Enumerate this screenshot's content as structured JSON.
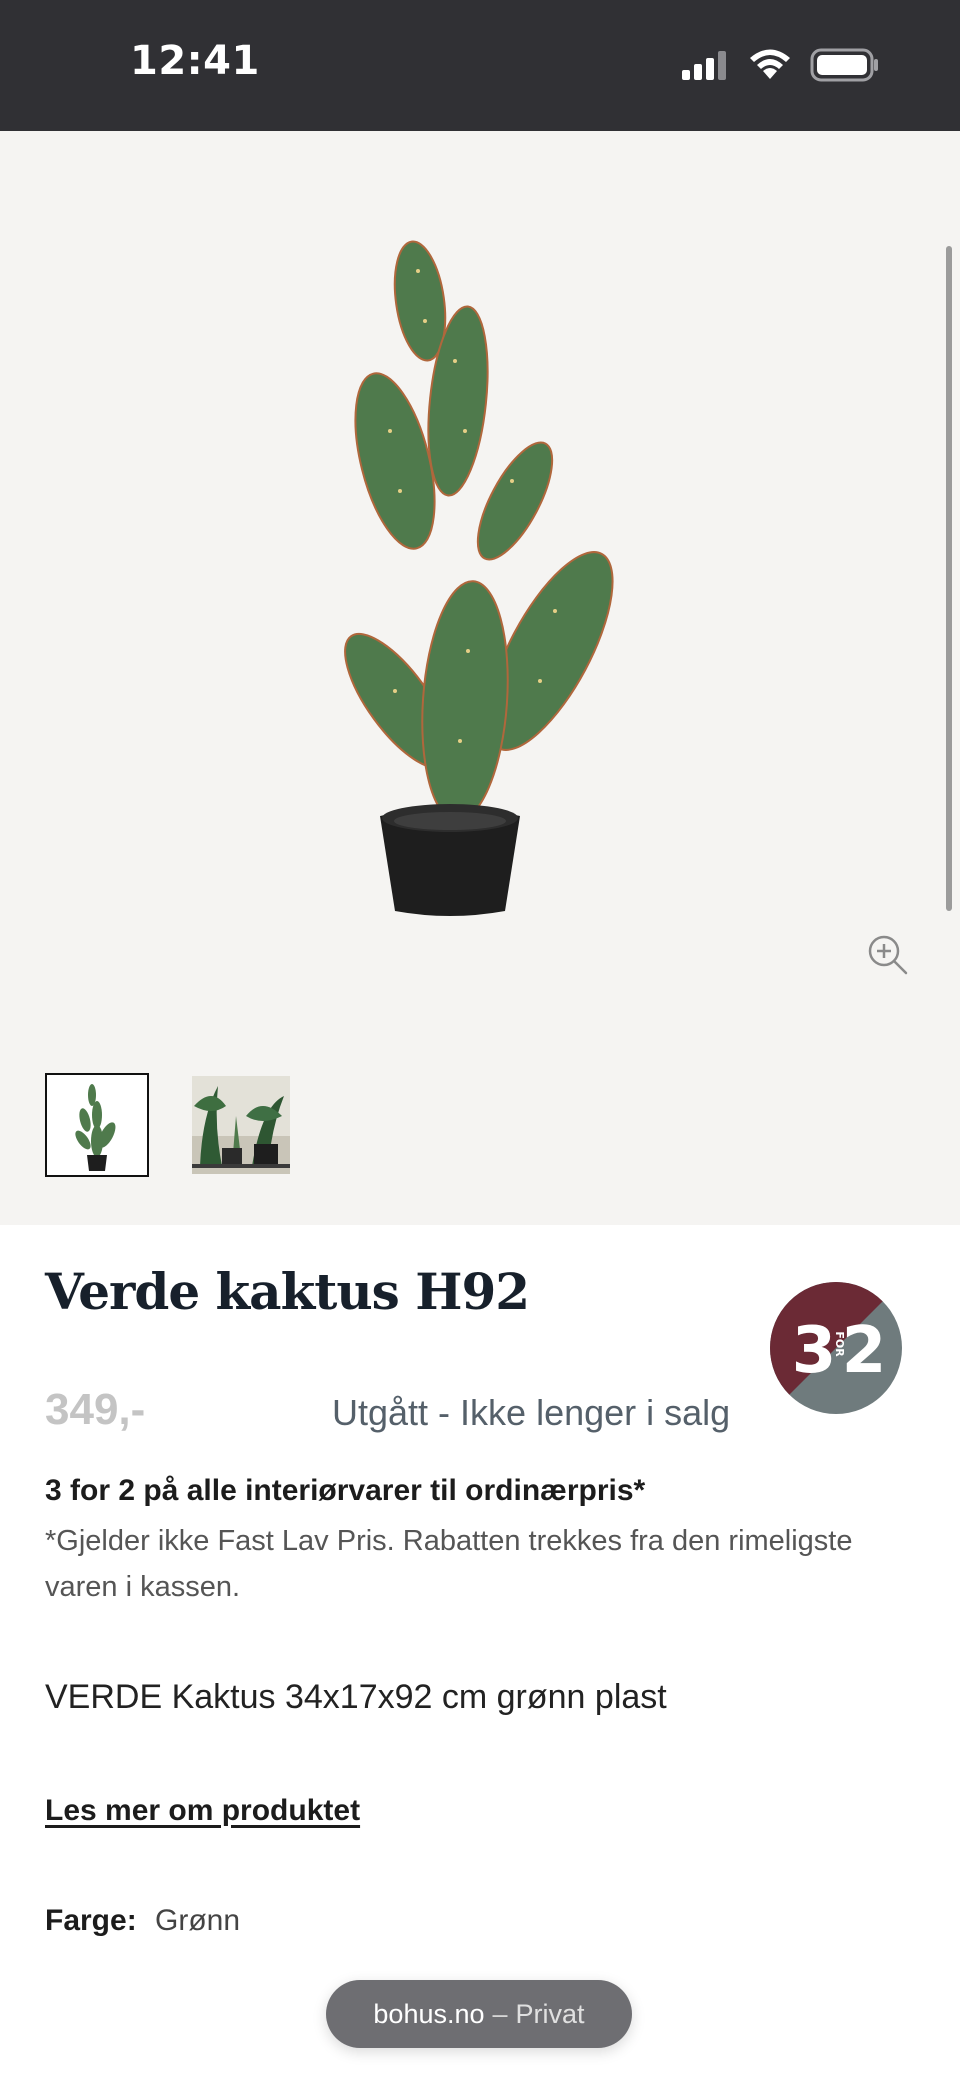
{
  "status_bar": {
    "time": "12:41",
    "icons": [
      "signal-icon",
      "wifi-icon",
      "battery-icon"
    ]
  },
  "gallery": {
    "zoom_icon": "zoom-in-icon",
    "thumbnail_count": 2
  },
  "product": {
    "title": "Verde kaktus H92",
    "price": "349,-",
    "availability": "Utgått - Ikke lenger i salg",
    "offer_title": "3 for 2 på alle interiørvarer til ordinærpris*",
    "offer_note": "*Gjelder ikke Fast Lav Pris. Rabatten trekkes fra den rimeligste varen i kassen.",
    "description": "VERDE Kaktus 34x17x92 cm grønn plast",
    "read_more": "Les mer om produktet",
    "color_label": "Farge:",
    "color_value": "Grønn"
  },
  "promo_badge": {
    "big_left": "3",
    "small": "FOR",
    "big_right": "2",
    "colors": {
      "top": "#6b2a35",
      "bottom": "#6f7b7d"
    }
  },
  "browser": {
    "domain": "bohus.no",
    "separator": "–",
    "mode": "Privat"
  },
  "colors": {
    "status_bar": "#303034",
    "gallery_bg": "#f5f4f2",
    "title": "#17202b",
    "availability": "#55606a"
  }
}
